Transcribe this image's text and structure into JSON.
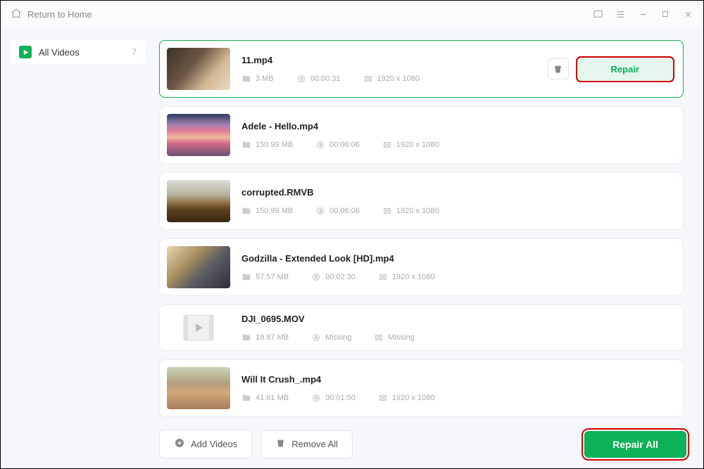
{
  "titlebar": {
    "return": "Return to Home"
  },
  "sidebar": {
    "label": "All Videos",
    "count": "7"
  },
  "files": [
    {
      "name": "11.mp4",
      "size": "3 MB",
      "duration": "00:00:31",
      "res": "1920 x 1080",
      "selected": true,
      "thumb": "th1",
      "repair_label": "Repair"
    },
    {
      "name": "Adele - Hello.mp4",
      "size": "150.99 MB",
      "duration": "00:06:06",
      "res": "1920 x 1080",
      "thumb": "th2"
    },
    {
      "name": "corrupted.RMVB",
      "size": "150.99 MB",
      "duration": "00:06:06",
      "res": "1920 x 1080",
      "thumb": "th3"
    },
    {
      "name": "Godzilla - Extended Look [HD].mp4",
      "size": "57.57 MB",
      "duration": "00:02:30",
      "res": "1920 x 1080",
      "thumb": "th4"
    },
    {
      "name": "DJI_0695.MOV",
      "size": "19.87 MB",
      "duration": "Missing",
      "res": "Missing",
      "placeholder": true
    },
    {
      "name": "Will It Crush_.mp4",
      "size": "41.61 MB",
      "duration": "00:01:50",
      "res": "1920 x 1080",
      "thumb": "th6"
    }
  ],
  "footer": {
    "add": "Add Videos",
    "remove": "Remove All",
    "repair_all": "Repair All"
  }
}
